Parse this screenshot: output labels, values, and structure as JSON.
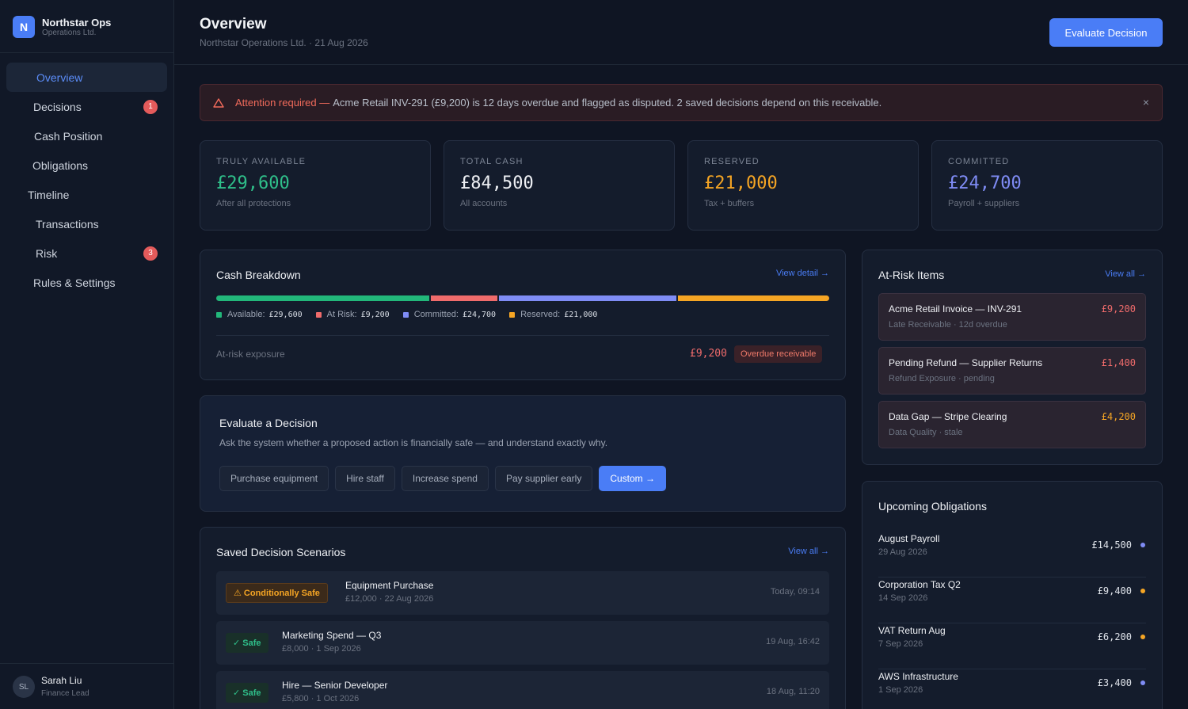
{
  "brand": {
    "logo": "N",
    "name": "Northstar Ops",
    "subtitle": "Operations Ltd."
  },
  "sidebar": {
    "items": [
      {
        "label": "Overview",
        "active": true
      },
      {
        "label": "Decisions",
        "badge": "1"
      },
      {
        "label": "Cash Position"
      },
      {
        "label": "Obligations"
      },
      {
        "label": "Timeline"
      },
      {
        "label": "Transactions"
      },
      {
        "label": "Risk",
        "badge": "3"
      },
      {
        "label": "Rules & Settings"
      }
    ]
  },
  "user": {
    "initials": "SL",
    "name": "Sarah Liu",
    "role": "Finance Lead"
  },
  "header": {
    "title": "Overview",
    "subtitle": "Northstar Operations Ltd. · 21 Aug 2026",
    "action": "Evaluate Decision"
  },
  "alert": {
    "icon": "warning-triangle-icon",
    "title": "Attention required —",
    "message": "Acme Retail INV-291 (£9,200) is 12 days overdue and flagged as disputed. 2 saved decisions depend on this receivable.",
    "close": "×"
  },
  "stats": [
    {
      "label": "TRULY AVAILABLE",
      "value": "£29,600",
      "sub": "After all protections",
      "color": "#2fbf8a"
    },
    {
      "label": "TOTAL CASH",
      "value": "£84,500",
      "sub": "All accounts",
      "color": "#eef0f4"
    },
    {
      "label": "RESERVED",
      "value": "£21,000",
      "sub": "Tax + buffers",
      "color": "#f5a524"
    },
    {
      "label": "COMMITTED",
      "value": "£24,700",
      "sub": "Payroll + suppliers",
      "color": "#7f8cf5"
    }
  ],
  "cash_breakdown": {
    "title": "Cash Breakdown",
    "link": "View detail →",
    "segments": [
      {
        "label": "Available:",
        "value": "£29,600",
        "amount": 29600,
        "color": "#22b77a"
      },
      {
        "label": "At Risk:",
        "value": "£9,200",
        "amount": 9200,
        "color": "#ef6b6b"
      },
      {
        "label": "Committed:",
        "value": "£24,700",
        "amount": 24700,
        "color": "#7f8cf5"
      },
      {
        "label": "Reserved:",
        "value": "£21,000",
        "amount": 21000,
        "color": "#f5a524"
      }
    ],
    "exposure_label": "At-risk exposure",
    "exposure_value": "£9,200",
    "exposure_badge": "Overdue receivable"
  },
  "evaluate": {
    "title": "Evaluate a Decision",
    "description": "Ask the system whether a proposed action is financially safe — and understand exactly why.",
    "options": [
      "Purchase equipment",
      "Hire staff",
      "Increase spend",
      "Pay supplier early"
    ],
    "custom": "Custom →"
  },
  "scenarios": {
    "title": "Saved Decision Scenarios",
    "link": "View all →",
    "items": [
      {
        "badge": "⚠ Conditionally Safe",
        "status": "warn",
        "name": "Equipment Purchase",
        "meta": "£12,000 · 22 Aug 2026",
        "time": "Today, 09:14"
      },
      {
        "badge": "✓ Safe",
        "status": "safe",
        "name": "Marketing Spend — Q3",
        "meta": "£8,000 · 1 Sep 2026",
        "time": "19 Aug, 16:42"
      },
      {
        "badge": "✓ Safe",
        "status": "safe",
        "name": "Hire — Senior Developer",
        "meta": "£5,800 · 1 Oct 2026",
        "time": "18 Aug, 11:20"
      }
    ]
  },
  "at_risk": {
    "title": "At-Risk Items",
    "link": "View all →",
    "items": [
      {
        "name": "Acme Retail Invoice — INV-291",
        "meta": "Late Receivable · 12d overdue",
        "amount": "£9,200",
        "color": "#ef6b6b"
      },
      {
        "name": "Pending Refund — Supplier Returns",
        "meta": "Refund Exposure · pending",
        "amount": "£1,400",
        "color": "#ef6b6b"
      },
      {
        "name": "Data Gap — Stripe Clearing",
        "meta": "Data Quality · stale",
        "amount": "£4,200",
        "color": "#f5a524"
      }
    ]
  },
  "obligations": {
    "title": "Upcoming Obligations",
    "items": [
      {
        "name": "August Payroll",
        "date": "29 Aug 2026",
        "amount": "£14,500",
        "dot": "#7f8cf5"
      },
      {
        "name": "Corporation Tax Q2",
        "date": "14 Sep 2026",
        "amount": "£9,400",
        "dot": "#f5a524"
      },
      {
        "name": "VAT Return Aug",
        "date": "7 Sep 2026",
        "amount": "£6,200",
        "dot": "#f5a524"
      },
      {
        "name": "AWS Infrastructure",
        "date": "1 Sep 2026",
        "amount": "£3,400",
        "dot": "#7f8cf5"
      }
    ]
  }
}
